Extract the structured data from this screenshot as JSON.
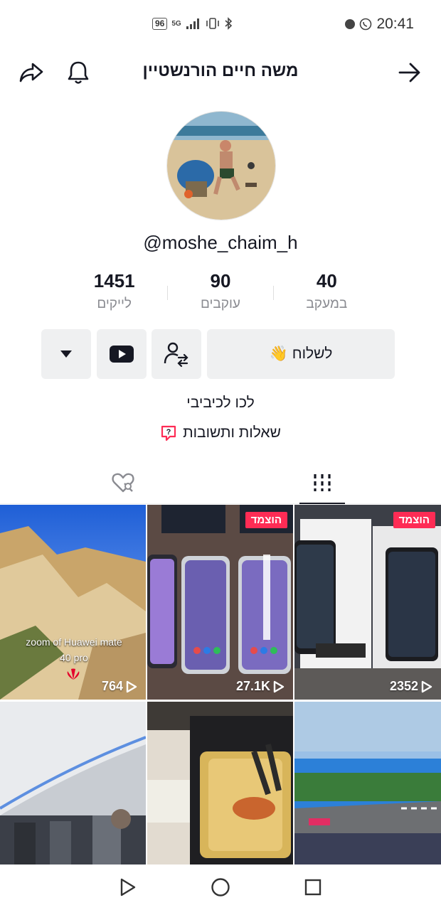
{
  "status_bar": {
    "battery": "96",
    "network": "5G",
    "time": "20:41"
  },
  "header": {
    "title": "משה חיים הורנשטיין"
  },
  "profile": {
    "username": "@moshe_chaim_h"
  },
  "stats": [
    {
      "value": "1451",
      "label": "לייקים"
    },
    {
      "value": "90",
      "label": "עוקבים"
    },
    {
      "value": "40",
      "label": "במעקב"
    }
  ],
  "actions": {
    "send_label": "לשלוח",
    "send_emoji": "👋"
  },
  "bio": {
    "text": "לכו לכיביבי",
    "qa_label": "שאלות ותשובות"
  },
  "videos": [
    {
      "views": "764",
      "overlay": "zoom of Huawei mate 40 pro",
      "pinned": false
    },
    {
      "views": "27.1K",
      "pinned": true,
      "pin_label": "הוצמד"
    },
    {
      "views": "2352",
      "pinned": true,
      "pin_label": "הוצמד"
    },
    {
      "views": ""
    },
    {
      "views": ""
    },
    {
      "views": ""
    }
  ],
  "icons": {
    "share": "share-arrow-icon",
    "bell": "bell-icon",
    "back": "arrow-right-icon",
    "follow_friends": "person-swap-icon",
    "youtube": "youtube-icon",
    "dropdown": "triangle-down-icon",
    "grid_tab": "grid-lines-icon",
    "liked_tab": "hidden-heart-icon",
    "qa": "question-bubble-icon"
  },
  "colors": {
    "accent": "#fe2c55",
    "button_bg": "#eff0f1",
    "text": "#161823",
    "muted": "#8a8b91"
  }
}
